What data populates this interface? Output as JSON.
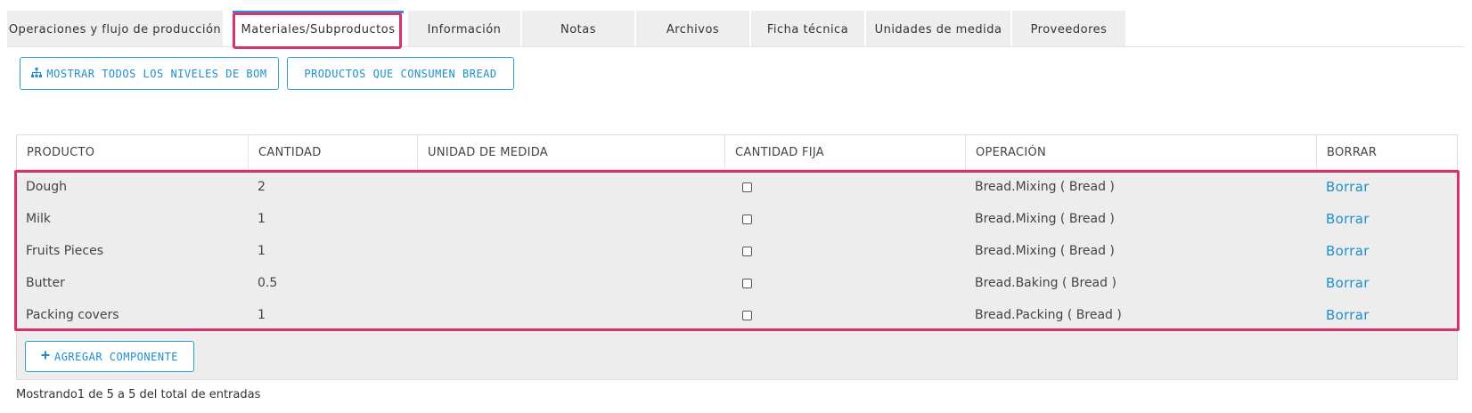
{
  "tabs": [
    {
      "label": "Operaciones y flujo de producción",
      "active": false
    },
    {
      "label": "Materiales/Subproductos",
      "active": true
    },
    {
      "label": "Información",
      "active": false
    },
    {
      "label": "Notas",
      "active": false
    },
    {
      "label": "Archivos",
      "active": false
    },
    {
      "label": "Ficha técnica",
      "active": false
    },
    {
      "label": "Unidades de medida",
      "active": false
    },
    {
      "label": "Proveedores",
      "active": false
    }
  ],
  "actions": {
    "show_bom_label": "MOSTRAR TODOS LOS NIVELES DE BOM",
    "consumers_label": "PRODUCTOS QUE CONSUMEN BREAD",
    "add_component_label": "AGREGAR COMPONENTE",
    "bom_icon": "sitemap-icon",
    "add_icon": "plus-icon"
  },
  "table": {
    "headers": [
      "PRODUCTO",
      "CANTIDAD",
      "UNIDAD DE MEDIDA",
      "CANTIDAD FIJA",
      "OPERACIÓN",
      "BORRAR"
    ],
    "rows": [
      {
        "producto": "Dough",
        "cantidad": "2",
        "unidad": "",
        "fija": false,
        "operacion": "Bread.Mixing ( Bread )",
        "borrar": "Borrar"
      },
      {
        "producto": "Milk",
        "cantidad": "1",
        "unidad": "",
        "fija": false,
        "operacion": "Bread.Mixing ( Bread )",
        "borrar": "Borrar"
      },
      {
        "producto": "Fruits Pieces",
        "cantidad": "1",
        "unidad": "",
        "fija": false,
        "operacion": "Bread.Mixing ( Bread )",
        "borrar": "Borrar"
      },
      {
        "producto": "Butter",
        "cantidad": "0.5",
        "unidad": "",
        "fija": false,
        "operacion": "Bread.Baking ( Bread )",
        "borrar": "Borrar"
      },
      {
        "producto": "Packing covers",
        "cantidad": "1",
        "unidad": "",
        "fija": false,
        "operacion": "Bread.Packing ( Bread )",
        "borrar": "Borrar"
      }
    ]
  },
  "footer": {
    "entries_text": "Mostrando1 de 5 a 5 del total de entradas"
  },
  "colors": {
    "accent": "#1e8fcd",
    "highlight": "#d6336c",
    "active_tab_bar": "#2f8fd8"
  }
}
